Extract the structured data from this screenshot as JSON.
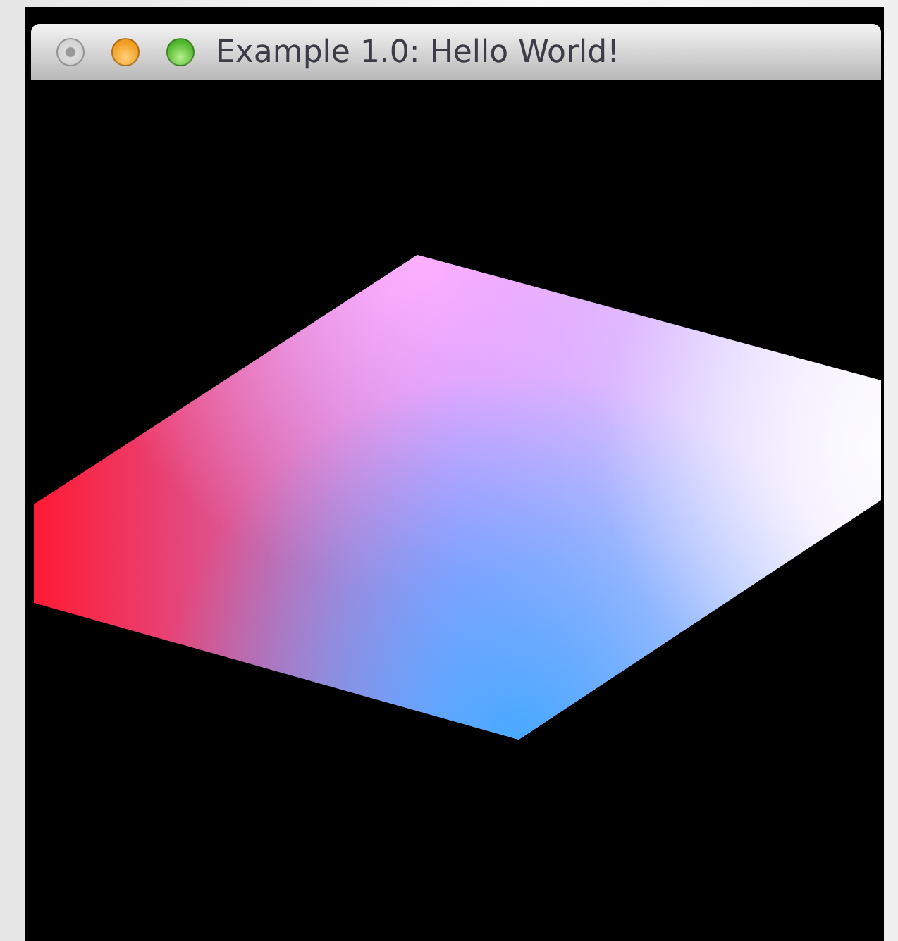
{
  "window": {
    "title": "Example 1.0: Hello World!"
  }
}
